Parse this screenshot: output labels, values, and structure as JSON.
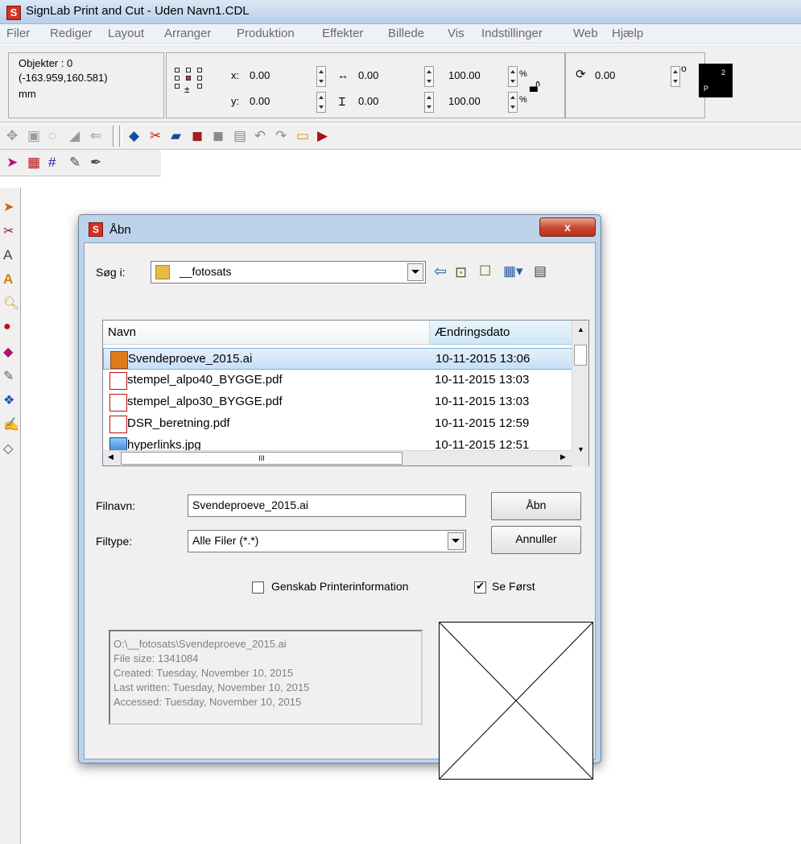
{
  "window": {
    "title": "SignLab Print and Cut - Uden Navn1.CDL"
  },
  "menu": [
    "Filer",
    "Rediger",
    "Layout",
    "Arranger",
    "Produktion",
    "Effekter",
    "Billede",
    "Vis",
    "Indstillinger",
    "Web",
    "Hjælp"
  ],
  "props": {
    "objects_label": "Objekter : 0",
    "coords": "(-163.959,160.581)",
    "unit": "mm",
    "x_label": "x:",
    "x_value": "0.00",
    "y_label": "y:",
    "y_value": "0.00",
    "w_value": "0.00",
    "h_value": "0.00",
    "scale_x": "100.00",
    "scale_y": "100.00",
    "pct": "%",
    "rotation": "0.00",
    "degree": "o",
    "page_top": "2",
    "page_bottom": "P"
  },
  "dialog": {
    "title": "Åbn",
    "close": "x",
    "lookin_label": "Søg i:",
    "lookin_value": "__fotosats",
    "columns": {
      "name": "Navn",
      "date": "Ændringsdato"
    },
    "files": [
      {
        "name": "Svendeproeve_2015.ai",
        "date": "10-11-2015 13:06",
        "type": "ai",
        "selected": true
      },
      {
        "name": "stempel_alpo40_BYGGE.pdf",
        "date": "10-11-2015 13:03",
        "type": "pdf"
      },
      {
        "name": "stempel_alpo30_BYGGE.pdf",
        "date": "10-11-2015 13:03",
        "type": "pdf"
      },
      {
        "name": "DSR_beretning.pdf",
        "date": "10-11-2015 12:59",
        "type": "pdf"
      },
      {
        "name": "hyperlinks.jpg",
        "date": "10-11-2015 12:51",
        "type": "jpg"
      }
    ],
    "hscroll_grip": "III",
    "filename_label": "Filnavn:",
    "filename_value": "Svendeproeve_2015.ai",
    "filetype_label": "Filtype:",
    "filetype_value": "Alle Filer (*.*)",
    "open_button": "Åbn",
    "cancel_button": "Annuller",
    "restore_printer": {
      "label": "Genskab Printerinformation",
      "checked": false
    },
    "preview_first": {
      "label": "Se Først",
      "checked": true
    },
    "info": [
      "O:\\__fotosats\\Svendeproeve_2015.ai",
      "File size: 1341084",
      "Created: Tuesday, November 10, 2015",
      "Last written: Tuesday, November 10, 2015",
      "Accessed: Tuesday, November 10, 2015"
    ]
  }
}
